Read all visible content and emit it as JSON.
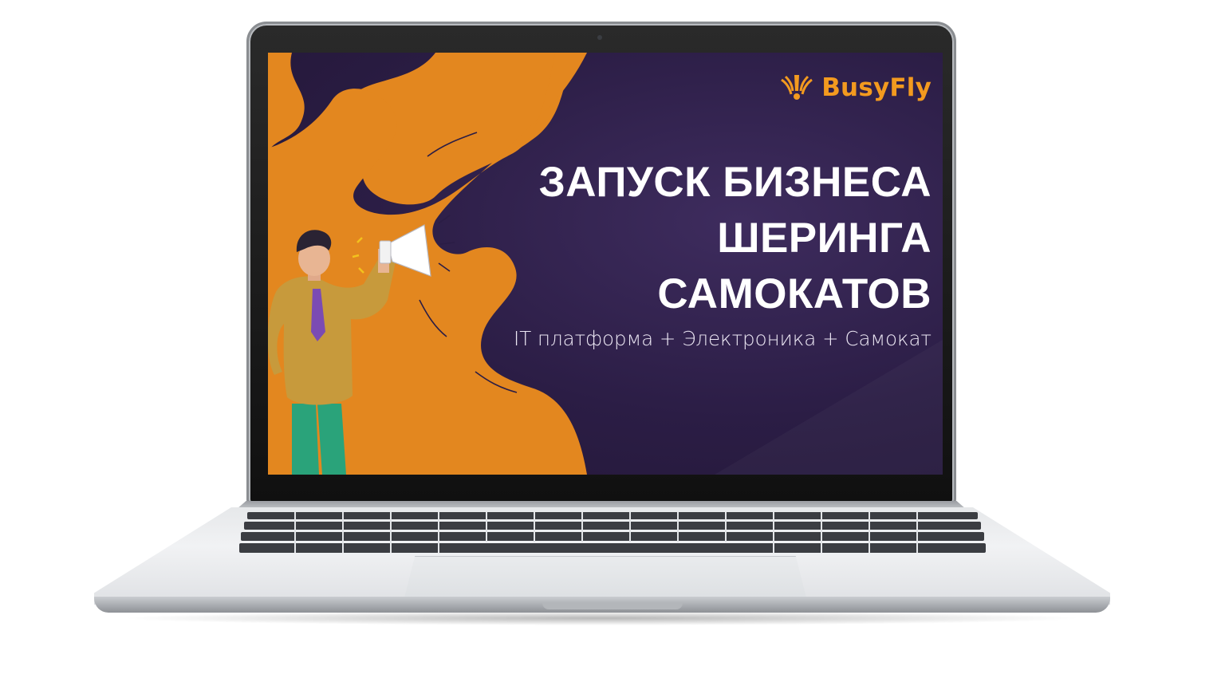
{
  "slide": {
    "logo_text": "BusyFly",
    "headline_lines": [
      "ЗАПУСК БИЗНЕСА",
      "ШЕРИНГА",
      "САМОКАТОВ"
    ],
    "subtitle": "IT платформа + Электроника + Самокат"
  },
  "colors": {
    "background_purple": "#2b1d45",
    "accent_orange": "#e68a1e",
    "logo_orange": "#f39a1f",
    "text_white": "#ffffff",
    "shirt": "#c79a3c",
    "tie": "#7b4bb3",
    "pants": "#2aa37a"
  },
  "icons": [
    "busyfly-logo-icon",
    "megaphone-icon"
  ]
}
